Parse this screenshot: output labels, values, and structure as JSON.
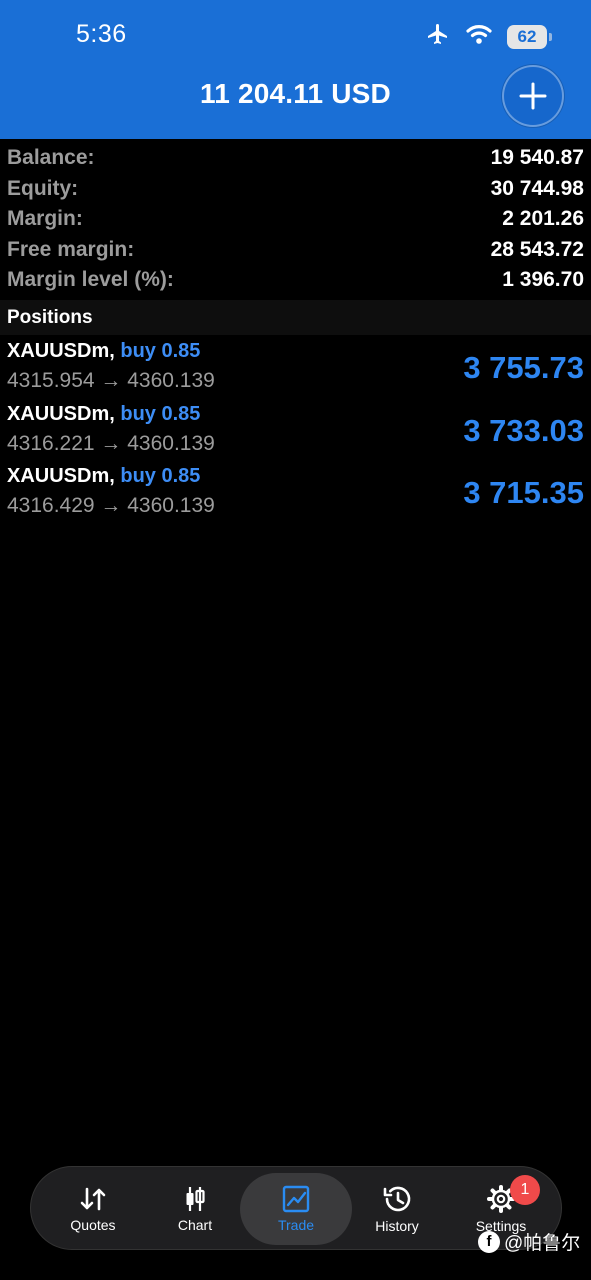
{
  "status_bar": {
    "time": "5:36",
    "battery": "62"
  },
  "header": {
    "title": "11 204.11 USD"
  },
  "summary": [
    {
      "label": "Balance:",
      "value": "19 540.87"
    },
    {
      "label": "Equity:",
      "value": "30 744.98"
    },
    {
      "label": "Margin:",
      "value": "2 201.26"
    },
    {
      "label": "Free margin:",
      "value": "28 543.72"
    },
    {
      "label": "Margin level (%):",
      "value": "1 396.70"
    }
  ],
  "positions": {
    "title": "Positions",
    "items": [
      {
        "symbol": "XAUUSDm,",
        "side": "buy 0.85",
        "prices": "4315.954 → 4360.139",
        "profit": "3 755.73"
      },
      {
        "symbol": "XAUUSDm,",
        "side": "buy 0.85",
        "prices": "4316.221 → 4360.139",
        "profit": "3 733.03"
      },
      {
        "symbol": "XAUUSDm,",
        "side": "buy 0.85",
        "prices": "4316.429 → 4360.139",
        "profit": "3 715.35"
      }
    ]
  },
  "tabs": [
    {
      "label": "Quotes",
      "icon": "quotes-icon"
    },
    {
      "label": "Chart",
      "icon": "candlestick-icon"
    },
    {
      "label": "Trade",
      "icon": "trade-chart-icon",
      "active": true
    },
    {
      "label": "History",
      "icon": "history-icon"
    },
    {
      "label": "Settings",
      "icon": "gear-icon",
      "badge": "1"
    }
  ],
  "watermark": {
    "text": "@帕鲁尔"
  },
  "colors": {
    "header": "#1a6fd6",
    "accent": "#2e86f2",
    "badge": "#f04a4a"
  }
}
